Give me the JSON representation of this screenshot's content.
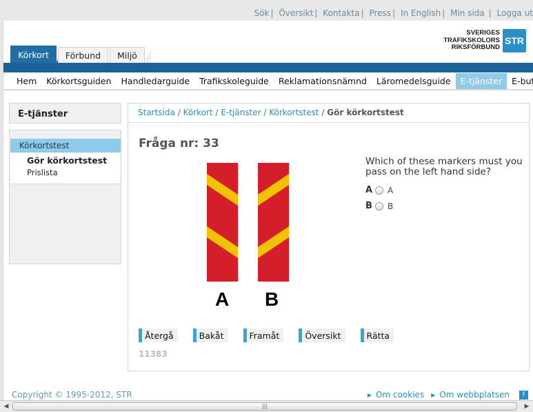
{
  "top_links": [
    "Sök",
    "Översikt",
    "Kontakta",
    "Press",
    "In English",
    "Min sida",
    "Logga ut"
  ],
  "logo": {
    "line1": "SVERIGES",
    "line2": "TRAFIKSKOLORS",
    "line3": "RIKSFÖRBUND",
    "badge": "STR"
  },
  "tabs": [
    {
      "label": "Körkort",
      "active": true
    },
    {
      "label": "Förbund",
      "active": false
    },
    {
      "label": "Miljö",
      "active": false
    }
  ],
  "nav": [
    {
      "label": "Hem"
    },
    {
      "label": "Körkortsguiden"
    },
    {
      "label": "Handledarguide"
    },
    {
      "label": "Trafikskoleguide"
    },
    {
      "label": "Reklamationsnämnd"
    },
    {
      "label": "Läromedelsguide"
    },
    {
      "label": "E-tjänster",
      "active": true
    },
    {
      "label": "E-butik"
    }
  ],
  "sidebar": {
    "heading": "E-tjänster",
    "section": "Körkortstest",
    "items": [
      {
        "label": "Gör körkortstest",
        "current": true
      },
      {
        "label": "Prislista",
        "current": false
      }
    ]
  },
  "breadcrumb": {
    "links": [
      "Startsida",
      "Körkort",
      "E-tjänster",
      "Körkortstest"
    ],
    "current": "Gör körkortstest",
    "sep": "/"
  },
  "question": {
    "title": "Fråga nr: 33",
    "text": "Which of these markers must you pass on the left hand side?",
    "image_labels": [
      "A",
      "B"
    ],
    "options": [
      {
        "letter": "A",
        "label": "A"
      },
      {
        "letter": "B",
        "label": "B"
      }
    ]
  },
  "buttons": [
    "Återgå",
    "Bakåt",
    "Framåt",
    "Översikt",
    "Rätta"
  ],
  "code": "11383",
  "footer": {
    "copyright": "Copyright © 1995-2012, STR",
    "links": [
      "Om cookies",
      "Om webbplatsen"
    ]
  },
  "colors": {
    "brand_blue": "#1a6399",
    "accent": "#2a8fc6",
    "sign_red": "#d41f2a",
    "sign_yellow": "#f2c200"
  }
}
